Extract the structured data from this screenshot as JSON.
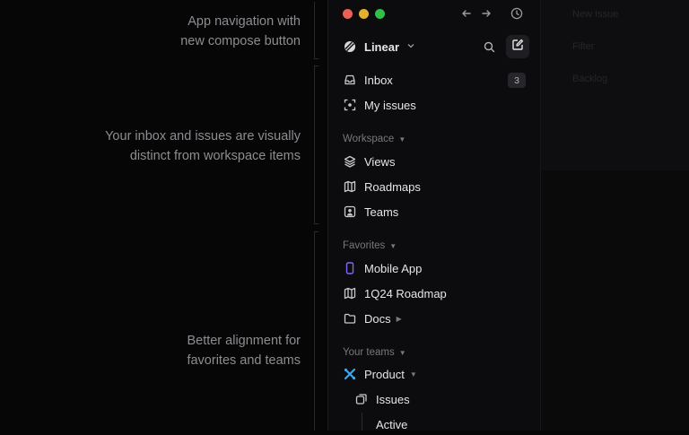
{
  "annotations": [
    {
      "text": "App navigation with\nnew compose button"
    },
    {
      "text": "Your inbox and issues are visually\ndistinct from workspace items"
    },
    {
      "text": "Better alignment for\nfavorites and teams"
    }
  ],
  "window": {
    "traffic_colors": [
      "#ec5f57",
      "#e1b12e",
      "#2fbf4a"
    ],
    "back_icon": "arrow-left-icon",
    "forward_icon": "arrow-right-icon",
    "history_icon": "clock-icon"
  },
  "header": {
    "workspace_name": "Linear",
    "search_icon": "search-icon",
    "compose_icon": "compose-icon"
  },
  "primary": [
    {
      "label": "Inbox",
      "icon": "inbox-icon",
      "badge": "3"
    },
    {
      "label": "My issues",
      "icon": "target-icon"
    }
  ],
  "workspace": {
    "title": "Workspace",
    "items": [
      {
        "label": "Views",
        "icon": "layers-icon"
      },
      {
        "label": "Roadmaps",
        "icon": "map-icon"
      },
      {
        "label": "Teams",
        "icon": "person-square-icon"
      }
    ]
  },
  "favorites": {
    "title": "Favorites",
    "items": [
      {
        "label": "Mobile App",
        "icon": "phone-icon",
        "accent": "#7c6af7"
      },
      {
        "label": "1Q24 Roadmap",
        "icon": "map-icon"
      },
      {
        "label": "Docs",
        "icon": "folder-icon"
      }
    ]
  },
  "teams": {
    "title": "Your teams",
    "items": [
      {
        "label": "Product",
        "icon": "product-team-icon",
        "accent": "#3aa7f5"
      },
      {
        "label": "Issues",
        "icon": "issues-icon"
      },
      {
        "label": "Active"
      }
    ]
  },
  "background_panel": {
    "texts": [
      "New Issue",
      "Filter",
      "Backlog"
    ]
  }
}
